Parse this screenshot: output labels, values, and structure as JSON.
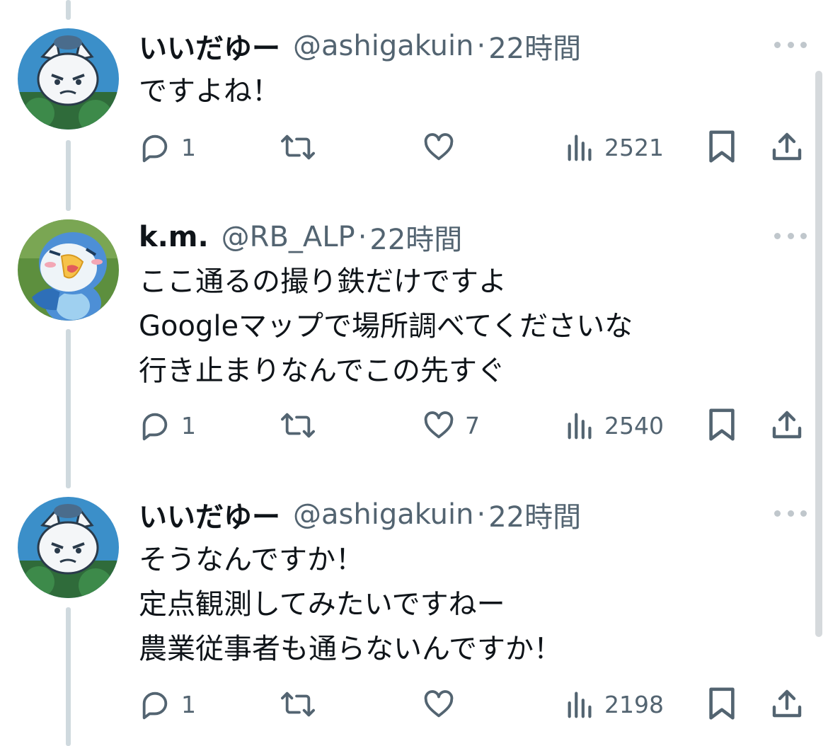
{
  "tweets": [
    {
      "name": "いいだゆー",
      "handle": "@ashigakuin",
      "dot": "·",
      "time": "22時間",
      "lines": [
        "ですよね！"
      ],
      "replies": "1",
      "retweets": "",
      "likes": "",
      "views": "2521",
      "avatar": "white-cat-character"
    },
    {
      "name": "k.m.",
      "handle": "@RB_ALP",
      "dot": "·",
      "time": "22時間",
      "lines": [
        "ここ通るの撮り鉄だけですよ",
        "Googleマップで場所調べてくださいな",
        "行き止まりなんでこの先すぐ"
      ],
      "replies": "1",
      "retweets": "",
      "likes": "7",
      "views": "2540",
      "avatar": "blue-penguin-character"
    },
    {
      "name": "いいだゆー",
      "handle": "@ashigakuin",
      "dot": "·",
      "time": "22時間",
      "lines": [
        "そうなんですか！",
        "定点観測してみたいですねー",
        "農業従事者も通らないんですか！"
      ],
      "replies": "1",
      "retweets": "",
      "likes": "",
      "views": "2198",
      "avatar": "white-cat-character"
    }
  ],
  "colors": {
    "text": "#0f1419",
    "secondary": "#536471",
    "icon": "#536471",
    "thread_line": "#cfd9de"
  }
}
